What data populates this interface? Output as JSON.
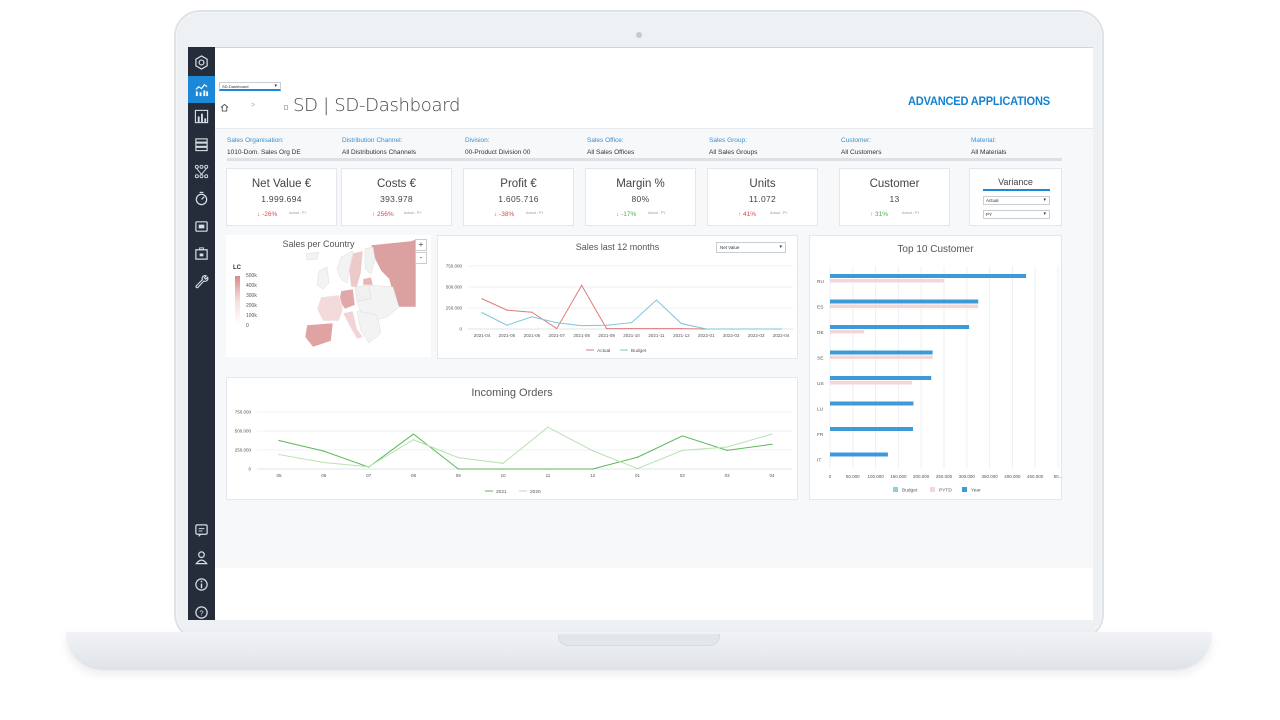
{
  "app": {
    "view_selector": "SD-Dashboard",
    "page_title": "SD | SD-Dashboard",
    "brand": "ADVANCED APPLICATIONS",
    "breadcrumb_sep": ">"
  },
  "sidebar": {
    "items": [
      {
        "icon": "hexagon-settings-icon",
        "active": false
      },
      {
        "icon": "analytics-chart-icon",
        "active": true
      },
      {
        "icon": "bar-report-icon",
        "active": false
      },
      {
        "icon": "list-rows-icon",
        "active": false
      },
      {
        "icon": "hierarchy-icon",
        "active": false
      },
      {
        "icon": "timer-icon",
        "active": false
      },
      {
        "icon": "monitor-icon",
        "active": false
      },
      {
        "icon": "briefcase-icon",
        "active": false
      },
      {
        "icon": "wrench-icon",
        "active": false
      }
    ],
    "bottom_items": [
      {
        "icon": "chat-icon"
      },
      {
        "icon": "user-icon"
      },
      {
        "icon": "info-icon"
      },
      {
        "icon": "help-icon"
      }
    ]
  },
  "filters": [
    {
      "label": "Sales Organisation:",
      "value": "1010-Dom. Sales Org DE"
    },
    {
      "label": "Distribution Channel:",
      "value": "All Distributions Channels"
    },
    {
      "label": "Division:",
      "value": "00-Product Division 00"
    },
    {
      "label": "Sales Office:",
      "value": "All Sales Offices"
    },
    {
      "label": "Sales Group:",
      "value": "All Sales Groups"
    },
    {
      "label": "Customer:",
      "value": "All Customers"
    },
    {
      "label": "Material:",
      "value": "All Materials"
    }
  ],
  "kpis": [
    {
      "title": "Net Value €",
      "value": "1.999.694",
      "delta": "↓ -26%",
      "delta_status": "bad",
      "note": "Actual - PY"
    },
    {
      "title": "Costs €",
      "value": "393.978",
      "delta": "↑ 256%",
      "delta_status": "bad",
      "note": "Actual - PY"
    },
    {
      "title": "Profit €",
      "value": "1.605.716",
      "delta": "↓ -38%",
      "delta_status": "bad",
      "note": "Actual - PY"
    },
    {
      "title": "Margin %",
      "value": "80%",
      "delta": "↓ -17%",
      "delta_status": "good",
      "note": "Actual - PY"
    },
    {
      "title": "Units",
      "value": "11.072",
      "delta": "↑ 41%",
      "delta_status": "bad",
      "note": "Actual - PY"
    },
    {
      "title": "Customer",
      "value": "13",
      "delta": "↑ 31%",
      "delta_status": "good",
      "note": "Actual - PY"
    }
  ],
  "variance": {
    "title": "Variance",
    "select_a": "Actual",
    "select_b": "PY"
  },
  "colors": {
    "accent": "#1e88d8",
    "brand": "#1582d0",
    "sidebar_bg": "#252d3a",
    "bad": "#e04848",
    "good": "#4cae4c"
  },
  "map": {
    "title": "Sales per Country",
    "legend_title": "LC",
    "legend_ticks": [
      "500k",
      "400k",
      "300k",
      "200k",
      "100k",
      "0"
    ],
    "zoom_in": "+",
    "zoom_out": "-"
  },
  "sales_chart": {
    "metric_select": "Net Value"
  },
  "chart_data": [
    {
      "id": "sales-last-12-months",
      "type": "line",
      "title": "Sales last 12 months",
      "categories": [
        "2021-04",
        "2021-05",
        "2021-06",
        "2021-07",
        "2021-08",
        "2021-09",
        "2021-10",
        "2021-11",
        "2021-12",
        "2022-01",
        "2022-02",
        "2022-03",
        "2022-04"
      ],
      "series": [
        {
          "name": "Actual",
          "color": "#e07a7a",
          "values": [
            360000,
            225000,
            200000,
            5000,
            520000,
            5000,
            5000,
            5000,
            5000,
            0,
            0,
            0,
            0
          ]
        },
        {
          "name": "Budget",
          "color": "#7cc6dc",
          "values": [
            195000,
            45000,
            145000,
            75000,
            40000,
            45000,
            75000,
            345000,
            65000,
            0,
            0,
            0,
            0
          ]
        }
      ],
      "y_ticks": [
        "0",
        "250.000",
        "500.000",
        "750.000"
      ],
      "ylim": [
        0,
        750000
      ],
      "grid": true,
      "legend": "bottom"
    },
    {
      "id": "incoming-orders",
      "type": "line",
      "title": "Incoming Orders",
      "categories": [
        "05",
        "06",
        "07",
        "08",
        "09",
        "10",
        "11",
        "12",
        "01",
        "02",
        "03",
        "04"
      ],
      "series": [
        {
          "name": "2021",
          "color": "#5cb85c",
          "values": [
            375000,
            235000,
            25000,
            460000,
            0,
            0,
            0,
            0,
            155000,
            435000,
            245000,
            325000
          ]
        },
        {
          "name": "2020",
          "color": "#b8e2b0",
          "values": [
            190000,
            85000,
            30000,
            385000,
            150000,
            75000,
            550000,
            240000,
            5000,
            245000,
            290000,
            460000
          ]
        }
      ],
      "y_ticks": [
        "0",
        "250.000",
        "500.000",
        "750.000"
      ],
      "ylim": [
        0,
        750000
      ],
      "grid": true,
      "legend": "bottom"
    },
    {
      "id": "top-10-customer",
      "type": "bar",
      "orientation": "horizontal",
      "title": "Top 10 Customer",
      "categories": [
        "RU",
        "ES",
        "DE",
        "SE",
        "US",
        "LU",
        "FR",
        "IT"
      ],
      "series": [
        {
          "name": "Budget",
          "color": "#8fcde0",
          "values": [
            0,
            0,
            0,
            0,
            0,
            0,
            0,
            0
          ]
        },
        {
          "name": "PYTD",
          "color": "#f4d6d9",
          "values": [
            250000,
            325000,
            75000,
            225000,
            180000,
            0,
            0,
            0
          ]
        },
        {
          "name": "Year",
          "color": "#3d9ad9",
          "values": [
            430000,
            325000,
            305000,
            225000,
            222000,
            183000,
            182000,
            127000
          ]
        }
      ],
      "x_ticks": [
        "0",
        "50.000",
        "100.000",
        "150.000",
        "200.000",
        "250.000",
        "300.000",
        "350.000",
        "400.000",
        "450.000",
        "50..."
      ],
      "xlim": [
        0,
        500000
      ],
      "grid": true,
      "legend": "bottom"
    }
  ]
}
